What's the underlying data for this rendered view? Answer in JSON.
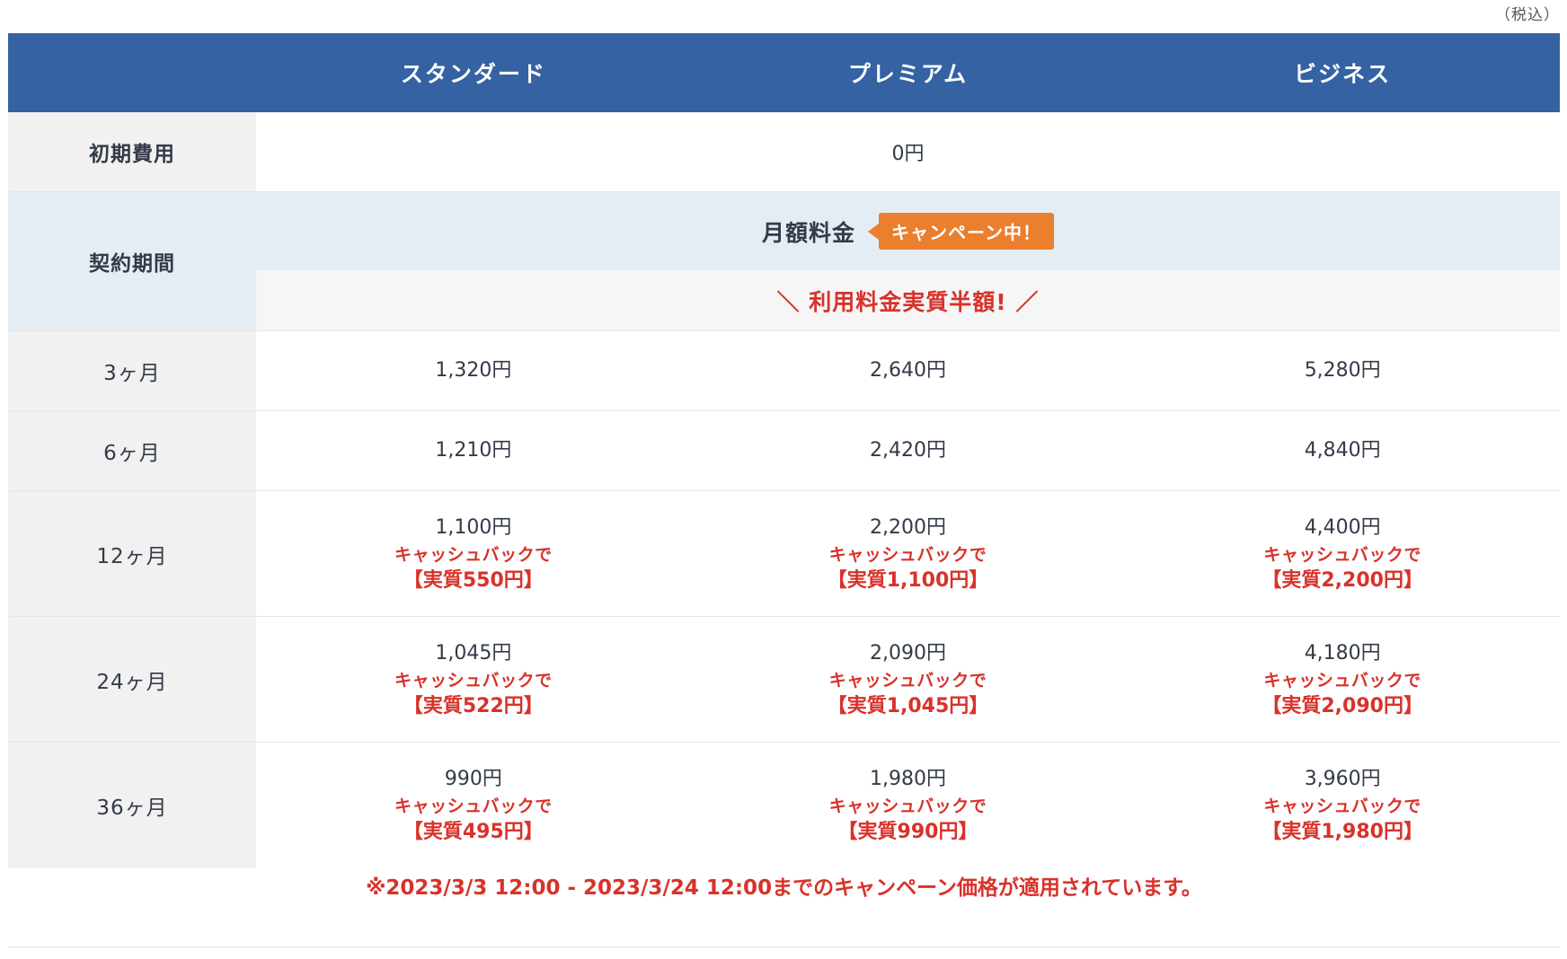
{
  "tax_note": "（税込）",
  "header": {
    "plans": [
      "スタンダード",
      "プレミアム",
      "ビジネス"
    ]
  },
  "initial_cost": {
    "label": "初期費用",
    "value": "0円"
  },
  "contract": {
    "label": "契約期間",
    "monthly_label": "月額料金",
    "campaign_badge": "キャンペーン中！",
    "half_price_banner": "＼ 利用料金実質半額! ／"
  },
  "rows": [
    {
      "label": "3ヶ月",
      "prices": [
        "1,320円",
        "2,640円",
        "5,280円"
      ]
    },
    {
      "label": "6ヶ月",
      "prices": [
        "1,210円",
        "2,420円",
        "4,840円"
      ]
    },
    {
      "label": "12ヶ月",
      "prices": [
        "1,100円",
        "2,200円",
        "4,400円"
      ],
      "cashback_label": "キャッシュバックで",
      "effective": [
        "【実質550円】",
        "【実質1,100円】",
        "【実質2,200円】"
      ]
    },
    {
      "label": "24ヶ月",
      "prices": [
        "1,045円",
        "2,090円",
        "4,180円"
      ],
      "cashback_label": "キャッシュバックで",
      "effective": [
        "【実質522円】",
        "【実質1,045円】",
        "【実質2,090円】"
      ]
    },
    {
      "label": "36ヶ月",
      "prices": [
        "990円",
        "1,980円",
        "3,960円"
      ],
      "cashback_label": "キャッシュバックで",
      "effective": [
        "【実質495円】",
        "【実質990円】",
        "【実質1,980円】"
      ]
    }
  ],
  "footnote": "※2023/3/3 12:00 - 2023/3/24 12:00までのキャンペーン価格が適用されています。",
  "colors": {
    "header_bg": "#3462a3",
    "accent_red": "#d8322a",
    "badge_orange": "#ea7f2e",
    "label_bg": "#f1f1f1",
    "contract_bg": "#e3edf3"
  }
}
